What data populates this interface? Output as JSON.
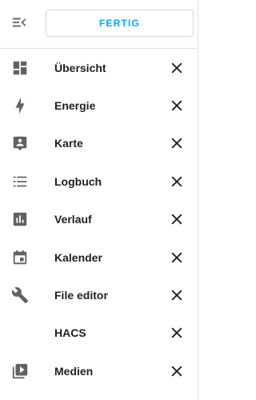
{
  "header": {
    "collapse_icon": "menu-collapse-icon",
    "done_label": "FERTIG",
    "accent_color": "#03a9f4"
  },
  "sidebar": {
    "items": [
      {
        "label": "Übersicht",
        "icon": "dashboard-icon"
      },
      {
        "label": "Energie",
        "icon": "lightning-bolt-icon"
      },
      {
        "label": "Karte",
        "icon": "account-box-icon"
      },
      {
        "label": "Logbuch",
        "icon": "format-list-bulleted-icon"
      },
      {
        "label": "Verlauf",
        "icon": "chart-box-icon"
      },
      {
        "label": "Kalender",
        "icon": "calendar-icon"
      },
      {
        "label": "File editor",
        "icon": "wrench-icon"
      },
      {
        "label": "HACS",
        "icon": ""
      },
      {
        "label": "Medien",
        "icon": "play-box-multiple-icon"
      }
    ],
    "remove_icon": "close-icon",
    "icon_color": "#616161",
    "text_color": "#212121"
  }
}
